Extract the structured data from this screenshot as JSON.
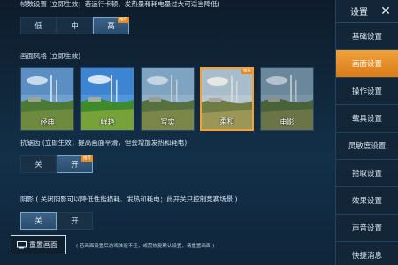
{
  "frame_rate": {
    "title": "帧数设置 (立即生效；若运行卡顿、发热量和耗电量过大可适当降低)",
    "options": [
      "低",
      "中",
      "高"
    ],
    "selected": "高",
    "recommended_badge": "推荐"
  },
  "graphics_style": {
    "title": "画面风格 (立即生效)",
    "styles": [
      "经典",
      "鲜艳",
      "写实",
      "柔和",
      "电影"
    ],
    "selected": "柔和",
    "recommended_badge": "推荐"
  },
  "anti_aliasing": {
    "title": "抗锯齿 (立即生效；提高画面平滑，但会增加发热和耗电)",
    "options": [
      "关",
      "开"
    ],
    "selected": "开",
    "recommended_badge": "推荐"
  },
  "shadow": {
    "title": "阴影 ( 关闭阴影可以降低性能损耗、发热和耗电；此开关只控制竞赛场景 )",
    "options": [
      "关",
      "开"
    ],
    "selected": "关"
  },
  "reset": {
    "button_label": "重置画面",
    "note": "( 若画面设置后游戏体验不佳，或需恢复默认设置，请重置画面 )"
  },
  "sidebar": {
    "title": "设置",
    "items": [
      "基础设置",
      "画面设置",
      "操作设置",
      "载具设置",
      "灵敏度设置",
      "拾取设置",
      "效果设置",
      "声音设置",
      "快捷消息"
    ],
    "active": "画面设置"
  },
  "icons": {
    "close": "close-icon",
    "reset": "monitor-icon"
  },
  "colors": {
    "accent": "#e8922a",
    "selected_bg": "#3b6286",
    "panel_bg": "#0f1d2b"
  }
}
